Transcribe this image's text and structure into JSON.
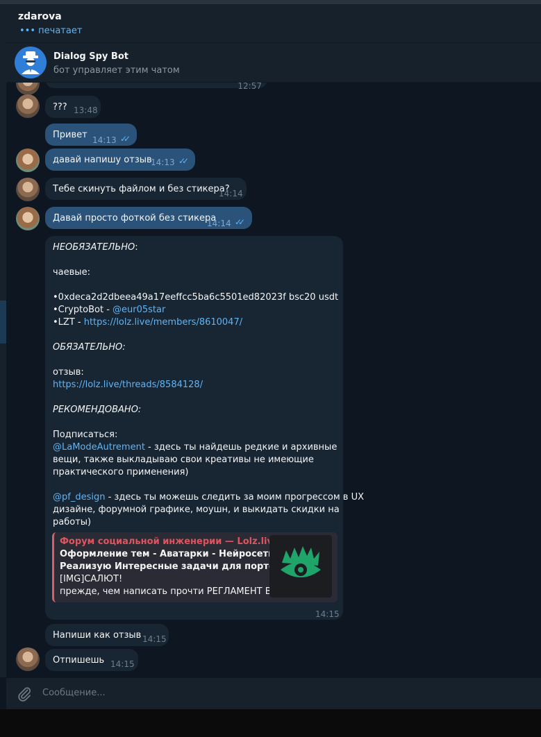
{
  "header": {
    "title": "zdarova",
    "status_dots": "•••",
    "status": "печатает"
  },
  "pinned": {
    "name": "Dialog Spy Bot",
    "desc": "бот управляет этим чатом",
    "avatar_icon": "spy-icon"
  },
  "messages": {
    "partial_time": "12:57",
    "m1": {
      "text": "???",
      "time": "13:48"
    },
    "m2": {
      "text": "Привет",
      "time": "14:13",
      "checks": "✓✓"
    },
    "m3": {
      "text": "давай напишу отзыв",
      "time": "14:13",
      "checks": "✓✓"
    },
    "m4": {
      "text": "Тебе скинуть файлом и без стикера?",
      "time": "14:14"
    },
    "m5": {
      "text": "Давай просто фоткой без стикера",
      "time": "14:14",
      "checks": "✓✓"
    },
    "big": {
      "l1": "НЕОБЯЗАТЕЛЬНО",
      "l1_tail": ":",
      "l2": "чаевые:",
      "l3": "•0xdeca2d2dbeea49a17eeffcc5ba6c5501ed82023f bsc20 usdt",
      "l4_pre": "•CryptoBot - ",
      "l4_link": "@eur05star",
      "l5_pre": "•LZT - ",
      "l5_link": "https://lolz.live/members/8610047/",
      "l6": "ОБЯЗАТЕЛЬНО:",
      "l7": "отзыв:",
      "l8_link": "https://lolz.live/threads/8584128/",
      "l9": "РЕКОМЕНДОВАНО:",
      "l10": "Подписаться:",
      "l11_link": "@LaModeAutrement",
      "l11_tail": " - здесь ты найдешь редкие и архивные",
      "l12": "вещи, также выкладываю свои креативы не имеющие",
      "l13": "практического применения)",
      "l14_link": "@pf_design",
      "l14_tail": " - здесь ты можешь следить за моим прогрессом в UX",
      "l15": "дизайне, форумной графике, моушн, и выкидать скидки на",
      "l16": "работы)",
      "preview": {
        "site": "Форум социальной инженерии — Lolz.live...",
        "title1": "Оформление тем - Аватарки - Нейросеть -",
        "title2": "Реализую Интересные задачи для портфо...",
        "desc1": "[IMG]САЛЮТ!",
        "desc2": "прежде, чем написать прочти РЕГЛАМЕНТ В..."
      },
      "time": "14:15"
    },
    "m6": {
      "text": "Напиши как отзыв",
      "time": "14:15"
    },
    "m7": {
      "text": "Отпишешь",
      "time": "14:15"
    }
  },
  "composer": {
    "placeholder": "Сообщение...",
    "attach_icon": "paperclip-icon"
  },
  "colors": {
    "bg": "#0e1621",
    "bubble_in": "#182533",
    "bubble_out": "#2b5278",
    "link": "#5eb5f7",
    "accent_red": "#e0545e"
  }
}
